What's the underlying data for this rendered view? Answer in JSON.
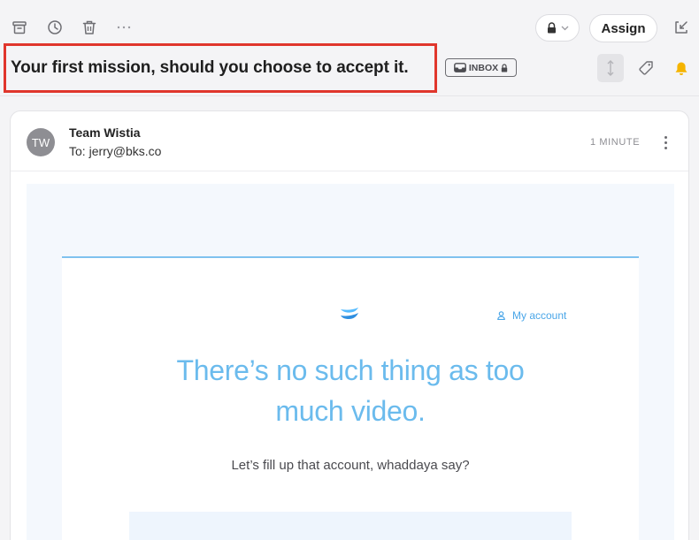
{
  "toolbar": {
    "archive_icon": "archive-icon",
    "snooze_icon": "clock-icon",
    "trash_icon": "trash-icon",
    "more_icon": "more-icon",
    "lock_icon": "lock-icon",
    "assign_label": "Assign",
    "popout_icon": "popout-icon"
  },
  "conversation": {
    "subject": "Your first mission, should you choose to accept it.",
    "inbox_badge": "INBOX",
    "highlight_color": "#e0362c"
  },
  "message": {
    "avatar_initials": "TW",
    "sender": "Team Wistia",
    "to_label": "To:",
    "to_address": "jerry@bks.co",
    "time": "1 MINUTE"
  },
  "email_body": {
    "account_link": "My account",
    "headline_line1": "There’s no such thing as too",
    "headline_line2": "much video.",
    "subline": "Let’s fill up that account, whaddaya say?",
    "accent_color": "#6bbbed"
  }
}
